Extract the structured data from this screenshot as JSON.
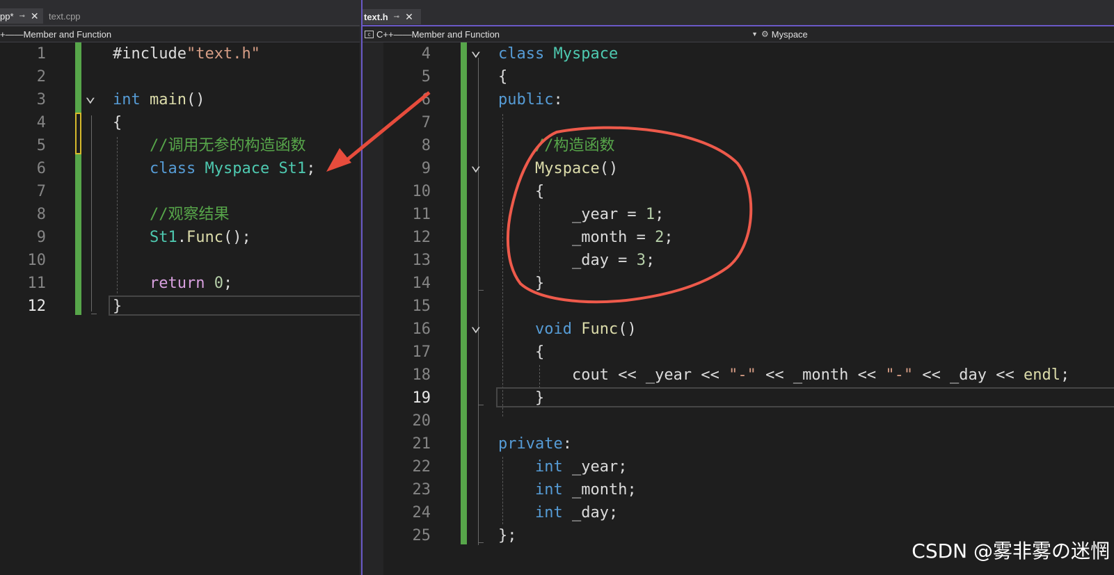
{
  "colors": {
    "background": "#1e1e1e",
    "keyword": "#569cd6",
    "type": "#4ec9b0",
    "function": "#dcdcaa",
    "comment": "#57a64a",
    "string": "#d69d85",
    "number": "#b5cea8",
    "control": "#d8a0df",
    "default": "#dcdcdc",
    "changed_marker": "#57a64a",
    "annotation_red": "#e74c3c",
    "accent": "#6a59c7"
  },
  "left": {
    "tabs": [
      {
        "label": "pp*",
        "active": true
      },
      {
        "label": "text.cpp",
        "active": false
      }
    ],
    "nav": {
      "scope": "+——Member and Function"
    },
    "current_line": "12",
    "lines": [
      {
        "n": "1",
        "tokens": [
          {
            "t": "#include",
            "c": "default"
          },
          {
            "t": "\"text.h\"",
            "c": "string"
          }
        ]
      },
      {
        "n": "2",
        "tokens": []
      },
      {
        "n": "3",
        "tokens": [
          {
            "t": "int",
            "c": "keyword"
          },
          {
            "t": " ",
            "c": "default"
          },
          {
            "t": "main",
            "c": "function"
          },
          {
            "t": "()",
            "c": "default"
          }
        ]
      },
      {
        "n": "4",
        "tokens": [
          {
            "t": "{",
            "c": "default"
          }
        ]
      },
      {
        "n": "5",
        "tokens": [
          {
            "t": "    //调用无参的构造函数",
            "c": "comment"
          }
        ]
      },
      {
        "n": "6",
        "tokens": [
          {
            "t": "    ",
            "c": "default"
          },
          {
            "t": "class",
            "c": "keyword"
          },
          {
            "t": " ",
            "c": "default"
          },
          {
            "t": "Myspace",
            "c": "type"
          },
          {
            "t": " ",
            "c": "default"
          },
          {
            "t": "St1",
            "c": "type"
          },
          {
            "t": ";",
            "c": "default"
          }
        ]
      },
      {
        "n": "7",
        "tokens": []
      },
      {
        "n": "8",
        "tokens": [
          {
            "t": "    //观察结果",
            "c": "comment"
          }
        ]
      },
      {
        "n": "9",
        "tokens": [
          {
            "t": "    ",
            "c": "default"
          },
          {
            "t": "St1",
            "c": "type"
          },
          {
            "t": ".",
            "c": "default"
          },
          {
            "t": "Func",
            "c": "function"
          },
          {
            "t": "();",
            "c": "default"
          }
        ]
      },
      {
        "n": "10",
        "tokens": []
      },
      {
        "n": "11",
        "tokens": [
          {
            "t": "    ",
            "c": "default"
          },
          {
            "t": "return",
            "c": "control"
          },
          {
            "t": " ",
            "c": "default"
          },
          {
            "t": "0",
            "c": "number"
          },
          {
            "t": ";",
            "c": "default"
          }
        ]
      },
      {
        "n": "12",
        "tokens": [
          {
            "t": "}",
            "c": "default"
          }
        ]
      }
    ]
  },
  "right": {
    "tabs": [
      {
        "label": "text.h",
        "active": true
      }
    ],
    "nav": {
      "scope": "C++——Member and Function",
      "member": "Myspace"
    },
    "current_line": "19",
    "lines": [
      {
        "n": "4",
        "tokens": [
          {
            "t": "class",
            "c": "keyword"
          },
          {
            "t": " ",
            "c": "default"
          },
          {
            "t": "Myspace",
            "c": "type"
          }
        ]
      },
      {
        "n": "5",
        "tokens": [
          {
            "t": "{",
            "c": "default"
          }
        ]
      },
      {
        "n": "6",
        "tokens": [
          {
            "t": "public",
            "c": "keyword"
          },
          {
            "t": ":",
            "c": "default"
          }
        ]
      },
      {
        "n": "7",
        "tokens": []
      },
      {
        "n": "8",
        "tokens": [
          {
            "t": "    //构造函数",
            "c": "comment"
          }
        ]
      },
      {
        "n": "9",
        "tokens": [
          {
            "t": "    ",
            "c": "default"
          },
          {
            "t": "Myspace",
            "c": "function"
          },
          {
            "t": "()",
            "c": "default"
          }
        ]
      },
      {
        "n": "10",
        "tokens": [
          {
            "t": "    {",
            "c": "default"
          }
        ]
      },
      {
        "n": "11",
        "tokens": [
          {
            "t": "        _year = ",
            "c": "default"
          },
          {
            "t": "1",
            "c": "number"
          },
          {
            "t": ";",
            "c": "default"
          }
        ]
      },
      {
        "n": "12",
        "tokens": [
          {
            "t": "        _month = ",
            "c": "default"
          },
          {
            "t": "2",
            "c": "number"
          },
          {
            "t": ";",
            "c": "default"
          }
        ]
      },
      {
        "n": "13",
        "tokens": [
          {
            "t": "        _day = ",
            "c": "default"
          },
          {
            "t": "3",
            "c": "number"
          },
          {
            "t": ";",
            "c": "default"
          }
        ]
      },
      {
        "n": "14",
        "tokens": [
          {
            "t": "    }",
            "c": "default"
          }
        ]
      },
      {
        "n": "15",
        "tokens": []
      },
      {
        "n": "16",
        "tokens": [
          {
            "t": "    ",
            "c": "default"
          },
          {
            "t": "void",
            "c": "keyword"
          },
          {
            "t": " ",
            "c": "default"
          },
          {
            "t": "Func",
            "c": "function"
          },
          {
            "t": "()",
            "c": "default"
          }
        ]
      },
      {
        "n": "17",
        "tokens": [
          {
            "t": "    {",
            "c": "default"
          }
        ]
      },
      {
        "n": "18",
        "tokens": [
          {
            "t": "        ",
            "c": "default"
          },
          {
            "t": "cout",
            "c": "default"
          },
          {
            "t": " << _year << ",
            "c": "default"
          },
          {
            "t": "\"-\"",
            "c": "string"
          },
          {
            "t": " << _month << ",
            "c": "default"
          },
          {
            "t": "\"-\"",
            "c": "string"
          },
          {
            "t": " << _day << ",
            "c": "default"
          },
          {
            "t": "endl",
            "c": "function"
          },
          {
            "t": ";",
            "c": "default"
          }
        ]
      },
      {
        "n": "19",
        "tokens": [
          {
            "t": "    }",
            "c": "default"
          }
        ]
      },
      {
        "n": "20",
        "tokens": []
      },
      {
        "n": "21",
        "tokens": [
          {
            "t": "private",
            "c": "keyword"
          },
          {
            "t": ":",
            "c": "default"
          }
        ]
      },
      {
        "n": "22",
        "tokens": [
          {
            "t": "    ",
            "c": "default"
          },
          {
            "t": "int",
            "c": "keyword"
          },
          {
            "t": " _year;",
            "c": "default"
          }
        ]
      },
      {
        "n": "23",
        "tokens": [
          {
            "t": "    ",
            "c": "default"
          },
          {
            "t": "int",
            "c": "keyword"
          },
          {
            "t": " _month;",
            "c": "default"
          }
        ]
      },
      {
        "n": "24",
        "tokens": [
          {
            "t": "    ",
            "c": "default"
          },
          {
            "t": "int",
            "c": "keyword"
          },
          {
            "t": " _day;",
            "c": "default"
          }
        ]
      },
      {
        "n": "25",
        "tokens": [
          {
            "t": "};",
            "c": "default"
          }
        ]
      }
    ]
  },
  "watermark": "CSDN @雾非雾の迷惘"
}
